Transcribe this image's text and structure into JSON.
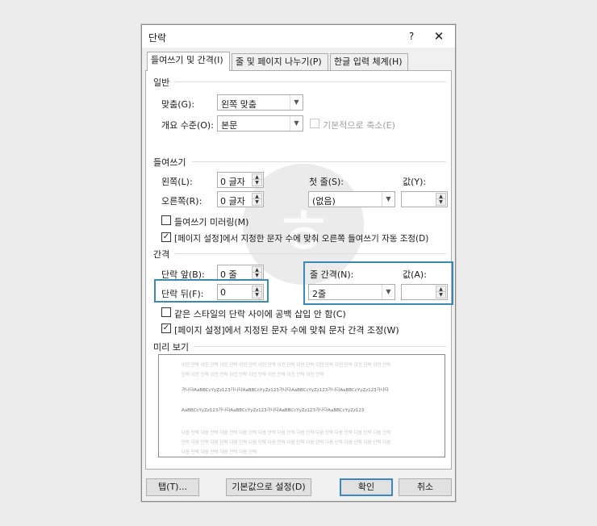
{
  "dialog": {
    "title": "단락",
    "help": "?",
    "close": "✕"
  },
  "tabs": [
    {
      "label": "들여쓰기 및 간격(I)"
    },
    {
      "label": "줄 및 페이지 나누기(P)"
    },
    {
      "label": "한글 입력 체계(H)"
    }
  ],
  "general": {
    "heading": "일반",
    "alignment_label": "맞춤(G):",
    "alignment_value": "왼쪽 맞춤",
    "outline_label": "개요 수준(O):",
    "outline_value": "본문",
    "collapsed_label": "기본적으로 축소(E)"
  },
  "indent": {
    "heading": "들여쓰기",
    "left_label": "왼쪽(L):",
    "left_value": "0 글자",
    "right_label": "오른쪽(R):",
    "right_value": "0 글자",
    "special_label": "첫 줄(S):",
    "special_value": "(없음)",
    "by_label": "값(Y):",
    "by_value": "",
    "mirror_label": "들여쓰기 미러링(M)",
    "grid_label": "[페이지 설정]에서 지정한 문자 수에 맞춰 오른쪽 들여쓰기 자동 조정(D)"
  },
  "spacing": {
    "heading": "간격",
    "before_label": "단락 앞(B):",
    "before_value": "0 줄",
    "after_label": "단락 뒤(F):",
    "after_value": "0",
    "line_label": "줄 간격(N):",
    "line_value": "2줄",
    "at_label": "값(A):",
    "at_value": "",
    "no_space_label": "같은 스타일의 단락 사이에 공백 삽입 안 함(C)",
    "snap_label": "[페이지 설정]에서 지정된 문자 수에 맞춰 문자 간격 조정(W)"
  },
  "preview": {
    "heading": "미리 보기",
    "prev_line1": "이전 단락 이전 단락 이전 단락 이전 단락 이전 단락 이전 단락 이전 단락 이전 단락 이전 단락 이전 단락 이전 단락",
    "prev_line2": "단락 이전 단락 이전 단락 이전 단락 이전 단락 이전 단락 이전 단락 이전 단락",
    "sample1": "가나다AaBBCcYyZz123가나다AaBBCcYyZz123가나다AaBBCcYyZz123가나다AaBBCcYyZz123가나다",
    "sample2": "AaBBCcYyZz123가나다AaBBCcYyZz123가나다AaBBCcYyZz123가나다AaBBCcYyZz123",
    "next_line1": "다음 단락 다음 단락 다음 단락 다음 단락 다음 단락 다음 단락 다음 단락 다음 단락 다음 단락 다음 단락 다음 단락",
    "next_line2": "단락 다음 단락 다음 단락 다음 단락 다음 단락 다음 단락 다음 단락 다음 단락 다음 단락 다음 단락 다음 단락 다음",
    "next_line3": "다음 단락 다음 단락 다음 단락 다음 단락"
  },
  "buttons": {
    "tabs": "탭(T)...",
    "default": "기본값으로 설정(D)",
    "ok": "확인",
    "cancel": "취소"
  },
  "colors": {
    "highlight": "#3a8ab5",
    "primary_border": "#3a86c8"
  }
}
